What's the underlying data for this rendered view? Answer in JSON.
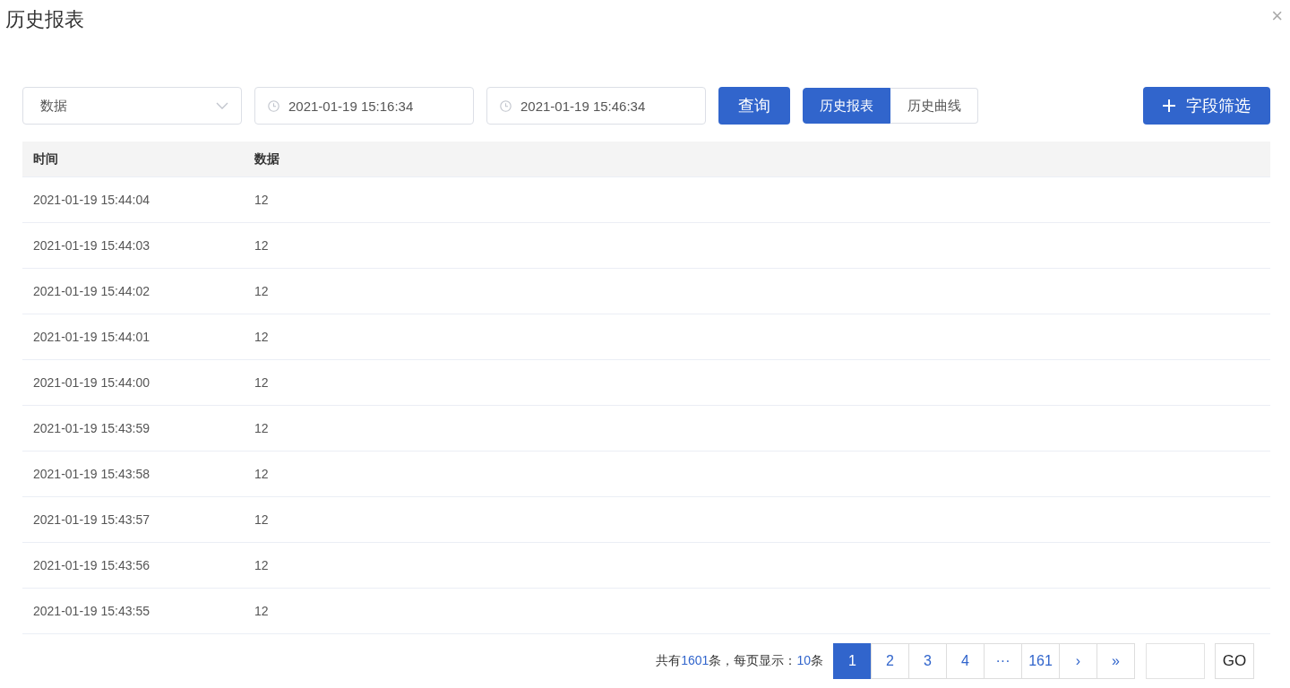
{
  "dialog": {
    "title": "历史报表",
    "close": "×"
  },
  "toolbar": {
    "field_select": {
      "value": "数据"
    },
    "start_time": {
      "value": "2021-01-19 15:16:34"
    },
    "end_time": {
      "value": "2021-01-19 15:46:34"
    },
    "query_button": "查询",
    "view_tabs": [
      {
        "label": "历史报表",
        "selected": true
      },
      {
        "label": "历史曲线",
        "selected": false
      }
    ],
    "filter_button": "字段筛选"
  },
  "table": {
    "columns": [
      "时间",
      "数据"
    ],
    "rows": [
      [
        "2021-01-19 15:44:04",
        "12"
      ],
      [
        "2021-01-19 15:44:03",
        "12"
      ],
      [
        "2021-01-19 15:44:02",
        "12"
      ],
      [
        "2021-01-19 15:44:01",
        "12"
      ],
      [
        "2021-01-19 15:44:00",
        "12"
      ],
      [
        "2021-01-19 15:43:59",
        "12"
      ],
      [
        "2021-01-19 15:43:58",
        "12"
      ],
      [
        "2021-01-19 15:43:57",
        "12"
      ],
      [
        "2021-01-19 15:43:56",
        "12"
      ],
      [
        "2021-01-19 15:43:55",
        "12"
      ]
    ]
  },
  "pagination": {
    "summary": [
      {
        "text": "共有",
        "highlight": false
      },
      {
        "text": "1601",
        "highlight": true
      },
      {
        "text": "条，每页显示：",
        "highlight": false
      },
      {
        "text": "10",
        "highlight": true
      },
      {
        "text": "条",
        "highlight": false
      }
    ],
    "pages": [
      {
        "label": "1",
        "selected": true
      },
      {
        "label": "2",
        "selected": false
      },
      {
        "label": "3",
        "selected": false
      },
      {
        "label": "4",
        "selected": false
      },
      {
        "label": "···",
        "selected": false
      },
      {
        "label": "161",
        "selected": false
      },
      {
        "label": "›",
        "selected": false
      },
      {
        "label": "»",
        "selected": false
      }
    ],
    "go_button": "GO"
  }
}
